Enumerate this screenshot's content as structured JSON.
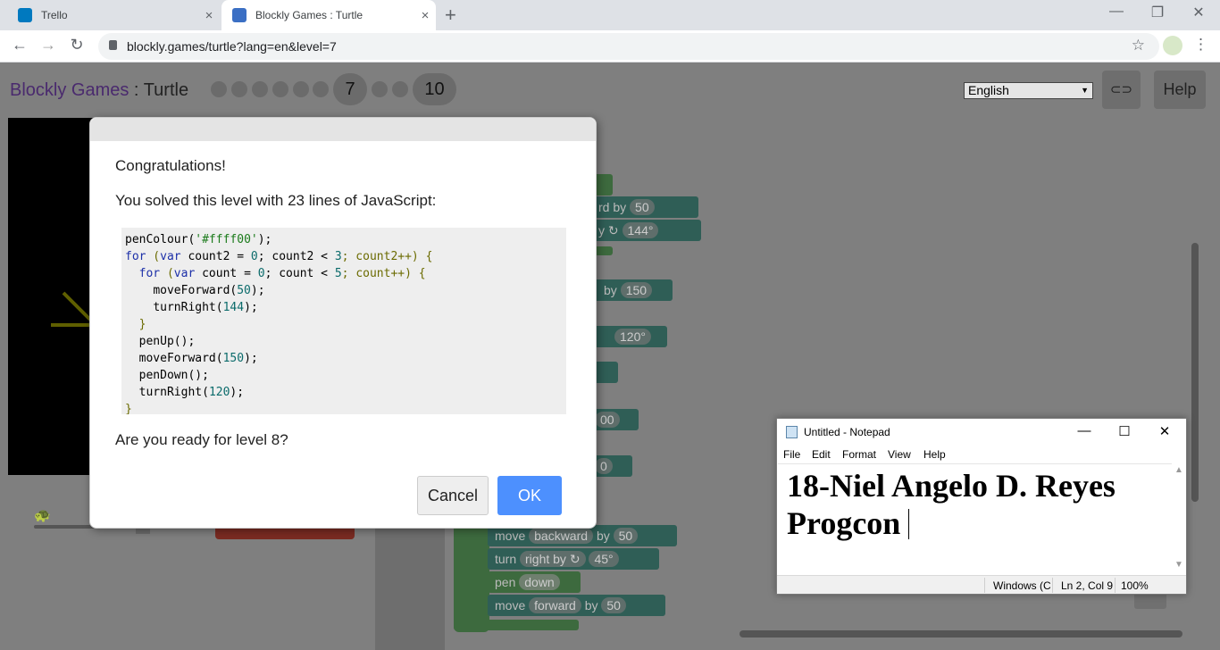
{
  "browser": {
    "tabs": [
      {
        "title": "Trello",
        "favicon_color": "#0079bf"
      },
      {
        "title": "Blockly Games : Turtle",
        "favicon_color": "#3b6fc4"
      }
    ],
    "tab_close_glyph": "×",
    "new_tab_glyph": "+",
    "url": "blockly.games/turtle?lang=en&level=7",
    "window_controls": {
      "minimize": "—",
      "restore": "❐",
      "close": "✕"
    },
    "nav": {
      "back": "←",
      "forward": "→",
      "reload": "↻",
      "star": "☆",
      "menu": "⋮"
    }
  },
  "app": {
    "brand": "Blockly Games",
    "separator": " : ",
    "title": "Turtle",
    "current_level": "7",
    "max_level": "10",
    "language": "English",
    "link_glyph": "⊂⊃",
    "help_label": "Help",
    "turtle_glyph": "🐢"
  },
  "workspace_blocks": [
    {
      "label": "",
      "fields": []
    },
    {
      "label": "rd",
      "fields": [
        "by",
        "50"
      ]
    },
    {
      "label": "y ↻",
      "fields": [
        "144°"
      ]
    },
    {
      "label": "by",
      "fields": [
        "150"
      ]
    },
    {
      "label": "",
      "fields": [
        "120°"
      ]
    },
    {
      "label": "",
      "fields": [
        "00"
      ]
    },
    {
      "label": "",
      "fields": [
        "0"
      ]
    },
    {
      "label": "move",
      "fields": [
        "backward",
        "by",
        "50"
      ]
    },
    {
      "label": "turn",
      "fields": [
        "right by ↻",
        "45°"
      ]
    },
    {
      "label": "pen",
      "fields": [
        "down"
      ]
    },
    {
      "label": "move",
      "fields": [
        "forward",
        "by",
        "50"
      ]
    }
  ],
  "dialog": {
    "heading": "Congratulations!",
    "summary": "You solved this level with 23 lines of JavaScript:",
    "question": "Are you ready for level 8?",
    "cancel_label": "Cancel",
    "ok_label": "OK",
    "code": {
      "l1": {
        "fn": "penColour(",
        "str": "'#ffff00'",
        "end": ");"
      },
      "l2": {
        "kw1": "for",
        "a": " (",
        "kw2": "var",
        "b": " count2 = ",
        "n1": "0",
        "c": "; count2 < ",
        "n2": "3",
        "d": "; count2++) {"
      },
      "l3": {
        "indent": "  ",
        "kw1": "for",
        "a": " (",
        "kw2": "var",
        "b": " count = ",
        "n1": "0",
        "c": "; count < ",
        "n2": "5",
        "d": "; count++) {"
      },
      "l4": {
        "indent": "    ",
        "fn": "moveForward(",
        "n": "50",
        "end": ");"
      },
      "l5": {
        "indent": "    ",
        "fn": "turnRight(",
        "n": "144",
        "end": ");"
      },
      "l6": {
        "indent": "  ",
        "text": "}"
      },
      "l7": {
        "indent": "  ",
        "fn": "penUp",
        "end": "();"
      },
      "l8": {
        "indent": "  ",
        "fn": "moveForward(",
        "n": "150",
        "end": ");"
      },
      "l9": {
        "indent": "  ",
        "fn": "penDown",
        "end": "();"
      },
      "l10": {
        "indent": "  ",
        "fn": "turnRight(",
        "n": "120",
        "end": ");"
      },
      "l11": {
        "text": "}"
      }
    }
  },
  "notepad": {
    "window_title": "Untitled - Notepad",
    "menu": [
      "File",
      "Edit",
      "Format",
      "View",
      "Help"
    ],
    "lines": [
      "18-Niel Angelo D. Reyes",
      "Progcon "
    ],
    "status": {
      "encoding": "Windows (C",
      "position": "Ln 2, Col 9",
      "zoom": "100%"
    },
    "controls": {
      "minimize": "—",
      "maximize": "☐",
      "close": "✕"
    },
    "scroll_up": "▲",
    "scroll_down": "▼"
  }
}
